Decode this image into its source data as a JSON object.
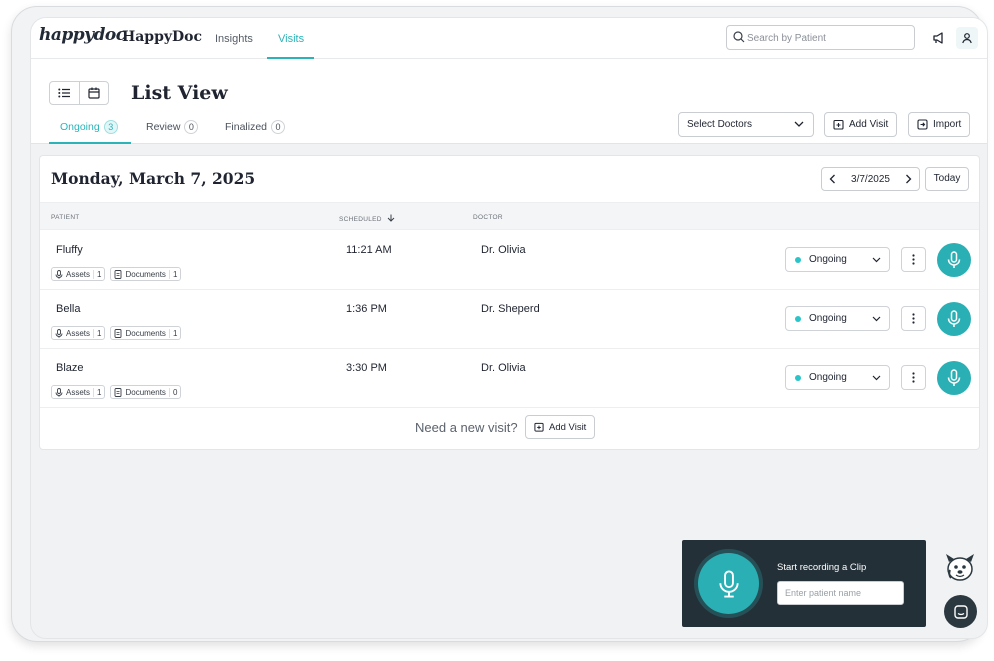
{
  "app": {
    "logo_text": "happydoc",
    "brand": "HappyDoc"
  },
  "nav": {
    "tabs": [
      {
        "label": "Insights",
        "active": false
      },
      {
        "label": "Visits",
        "active": true
      }
    ],
    "search_placeholder": "Search by Patient",
    "icons": [
      "megaphone-icon",
      "user-icon"
    ]
  },
  "header": {
    "title": "List View",
    "tabs": [
      {
        "label": "Ongoing",
        "count": "3",
        "active": true
      },
      {
        "label": "Review",
        "count": "0",
        "active": false
      },
      {
        "label": "Finalized",
        "count": "0",
        "active": false
      }
    ],
    "select_doctors": "Select Doctors",
    "add_visit": "Add Visit",
    "import": "Import"
  },
  "date_card": {
    "title": "Monday, March 7, 2025",
    "date_nav": "3/7/2025",
    "today": "Today",
    "columns": {
      "patient": "PATIENT",
      "scheduled": "SCHEDULED",
      "doctor": "DOCTOR"
    },
    "rows": [
      {
        "patient": "Fluffy",
        "assets_label": "Assets",
        "assets": "1",
        "documents_label": "Documents",
        "documents": "1",
        "scheduled": "11:21 AM",
        "doctor": "Dr. Olivia",
        "status": "Ongoing"
      },
      {
        "patient": "Bella",
        "assets_label": "Assets",
        "assets": "1",
        "documents_label": "Documents",
        "documents": "1",
        "scheduled": "1:36 PM",
        "doctor": "Dr. Sheperd",
        "status": "Ongoing"
      },
      {
        "patient": "Blaze",
        "assets_label": "Assets",
        "assets": "1",
        "documents_label": "Documents",
        "documents": "0",
        "scheduled": "3:30 PM",
        "doctor": "Dr. Olivia",
        "status": "Ongoing"
      }
    ],
    "footer_prompt": "Need a new visit?",
    "footer_add_visit": "Add Visit"
  },
  "recorder": {
    "title": "Start recording a Clip",
    "placeholder": "Enter patient name"
  },
  "colors": {
    "accent": "#2bb3b8",
    "recorder_bg": "#233038",
    "status_dot": "#2bc4c8"
  }
}
